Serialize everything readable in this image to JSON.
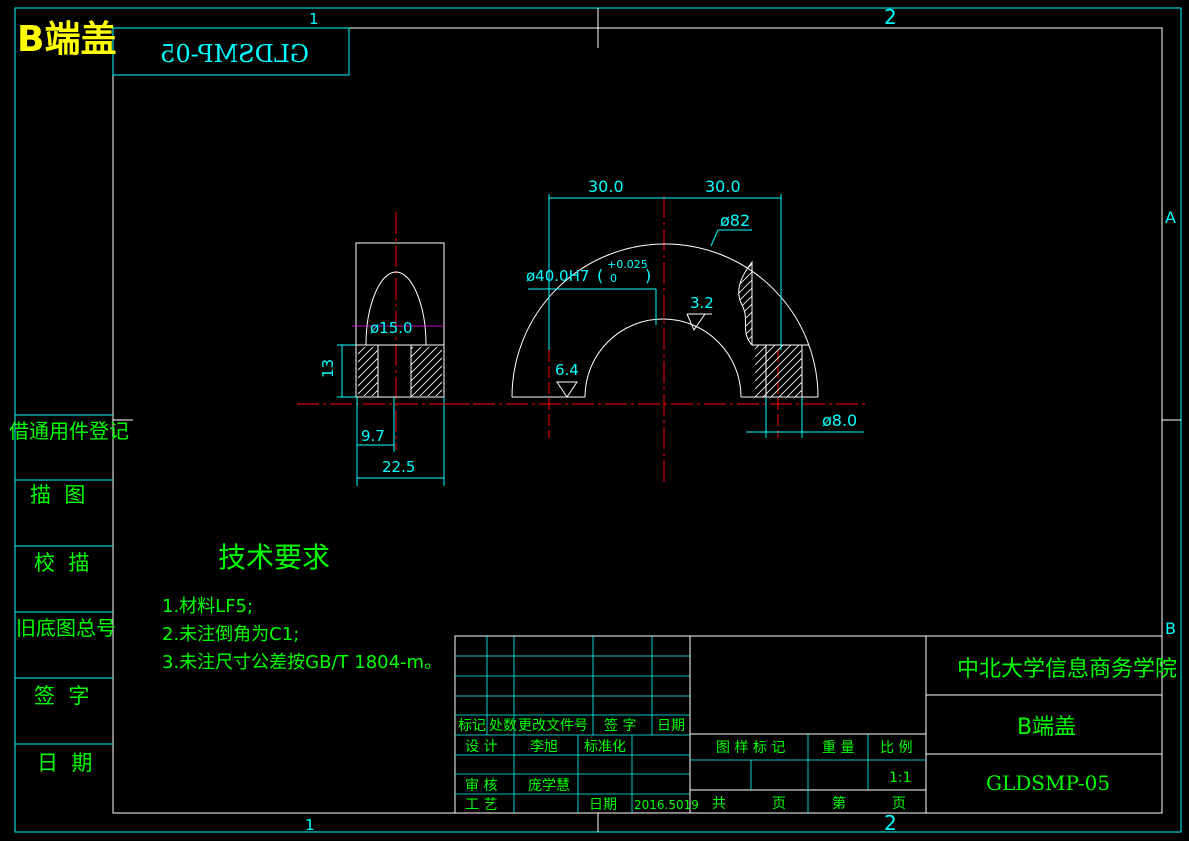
{
  "header": {
    "part_title": "B端盖",
    "drawing_code_mirrored": "GLDSMP-05"
  },
  "zone_marks": {
    "top_1": "1",
    "top_2": "2",
    "bottom_1": "1",
    "bottom_2": "2",
    "right_a": "A",
    "right_b": "B"
  },
  "side_table": {
    "rows": [
      "借通用件登记",
      "描  图",
      "校  描",
      "旧底图总号",
      "签  字",
      "日  期"
    ]
  },
  "dimensions": {
    "d30_left": "30.0",
    "d30_right": "30.0",
    "phi82": "ø82",
    "phi40_main": "ø40.0H7",
    "phi40_tol_upper": "+0.025",
    "phi40_tol_lower": "0",
    "rough_3_2": "3.2",
    "rough_6_4": "6.4",
    "phi15": "ø15.0",
    "d13": "13",
    "d9_7": "9.7",
    "d22_5": "22.5",
    "phi8": "ø8.0"
  },
  "tech_requirements": {
    "title": "技术要求",
    "items": [
      "1.材料LF5;",
      "2.未注倒角为C1;",
      "3.未注尺寸公差按GB/T 1804-m。"
    ]
  },
  "title_block": {
    "school": "中北大学信息商务学院",
    "part_name": "B端盖",
    "drawing_no": "GLDSMP-05",
    "rev_header": [
      "标记",
      "处数",
      "更改文件号",
      "签 字",
      "日期"
    ],
    "design_label": "设 计",
    "designer": "李旭",
    "standardize_label": "标准化",
    "review_label": "审 核",
    "reviewer": "庞学慧",
    "process_label": "工 艺",
    "date_label": "日期",
    "date_value": "2016.5019",
    "stage_label": "图 样 标 记",
    "weight_label": "重 量",
    "scale_label": "比 例",
    "scale_value": "1:1",
    "total_label": "共",
    "page_label": "页",
    "sheet_label": "第",
    "sheet_page_label": "页"
  }
}
